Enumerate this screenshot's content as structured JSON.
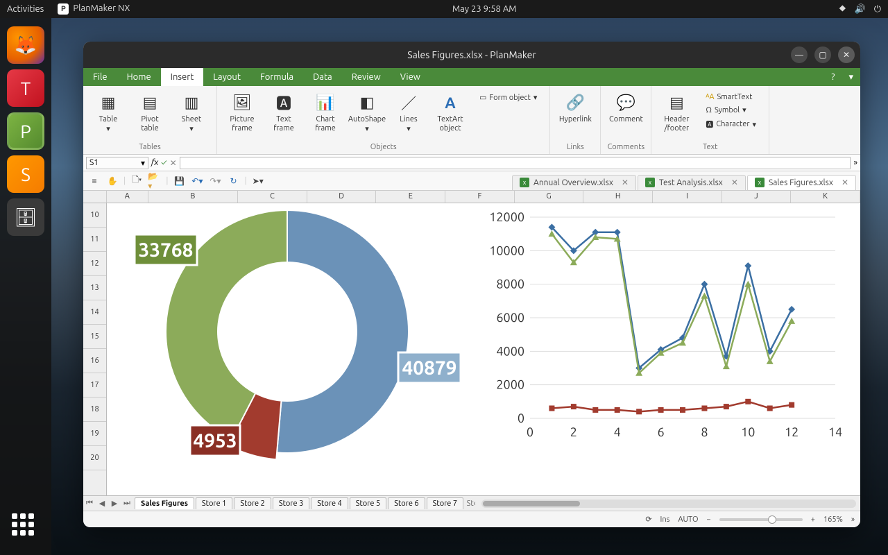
{
  "panel": {
    "activities": "Activities",
    "app_name": "PlanMaker NX",
    "clock": "May 23  9:58 AM"
  },
  "window": {
    "title": "Sales Figures.xlsx - PlanMaker"
  },
  "menu": {
    "file": "File",
    "home": "Home",
    "insert": "Insert",
    "layout": "Layout",
    "formula": "Formula",
    "data": "Data",
    "review": "Review",
    "view": "View"
  },
  "ribbon": {
    "tables": {
      "table": "Table",
      "pivot": "Pivot table",
      "sheet": "Sheet",
      "group": "Tables"
    },
    "objects": {
      "picture": "Picture frame",
      "text": "Text frame",
      "chart": "Chart frame",
      "autoshape": "AutoShape",
      "lines": "Lines",
      "textart": "TextArt object",
      "formobj": "Form object",
      "group": "Objects"
    },
    "links": {
      "hyperlink": "Hyperlink",
      "group": "Links"
    },
    "comments": {
      "comment": "Comment",
      "group": "Comments"
    },
    "text": {
      "header": "Header /footer",
      "smarttext": "SmartText",
      "symbol": "Symbol",
      "character": "Character",
      "group": "Text"
    }
  },
  "cellref": "S1",
  "file_tabs": [
    "Annual Overview.xlsx",
    "Test Analysis.xlsx",
    "Sales Figures.xlsx"
  ],
  "active_file_tab": 2,
  "columns": [
    "A",
    "B",
    "C",
    "D",
    "E",
    "F",
    "G",
    "H",
    "I",
    "J",
    "K"
  ],
  "rows": [
    "10",
    "11",
    "12",
    "13",
    "14",
    "15",
    "16",
    "17",
    "18",
    "19",
    "20"
  ],
  "sheet_tabs": [
    "Sales Figures",
    "Store 1",
    "Store 2",
    "Store 3",
    "Store 4",
    "Store 5",
    "Store 6",
    "Store 7"
  ],
  "active_sheet": 0,
  "status": {
    "ins": "Ins",
    "auto": "AUTO",
    "zoom": "165%",
    "minus": "−",
    "plus": "+"
  },
  "chart_data": [
    {
      "type": "pie",
      "subtype": "donut",
      "series": [
        {
          "name": "blue",
          "value": 40879,
          "color": "#6b92b8"
        },
        {
          "name": "red",
          "value": 4953,
          "color": "#a23b2e"
        },
        {
          "name": "green",
          "value": 33768,
          "color": "#8cab5a"
        }
      ],
      "labels": {
        "blue": "40879",
        "red": "4953",
        "green": "33768"
      }
    },
    {
      "type": "line",
      "x": [
        1,
        2,
        3,
        4,
        5,
        6,
        7,
        8,
        9,
        10,
        11,
        12
      ],
      "series": [
        {
          "name": "blue",
          "color": "#3b6fa3",
          "marker": "diamond",
          "values": [
            11400,
            10000,
            11100,
            11100,
            3000,
            4100,
            4800,
            8000,
            3700,
            9100,
            4000,
            6500
          ]
        },
        {
          "name": "green",
          "color": "#8cab5a",
          "marker": "triangle",
          "values": [
            11000,
            9300,
            10800,
            10700,
            2700,
            3900,
            4500,
            7300,
            3100,
            8000,
            3400,
            5800
          ]
        },
        {
          "name": "red",
          "color": "#a23b2e",
          "marker": "square",
          "values": [
            600,
            700,
            500,
            500,
            400,
            500,
            500,
            600,
            700,
            1000,
            600,
            800
          ]
        }
      ],
      "xlim": [
        0,
        14
      ],
      "ylim": [
        0,
        12000
      ],
      "xticks": [
        0,
        2,
        4,
        6,
        8,
        10,
        12,
        14
      ],
      "yticks": [
        0,
        2000,
        4000,
        6000,
        8000,
        10000,
        12000
      ]
    }
  ]
}
